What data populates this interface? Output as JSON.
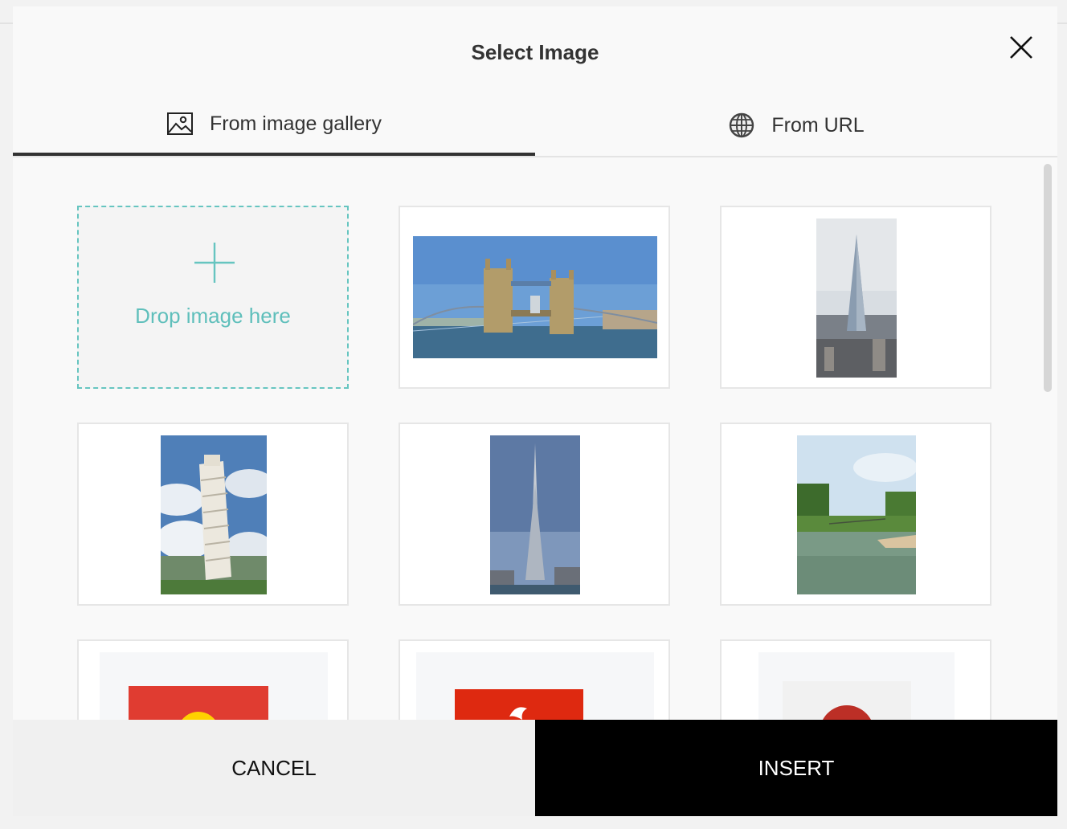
{
  "modal": {
    "title": "Select Image",
    "close_icon": "close-icon"
  },
  "tabs": [
    {
      "label": "From image gallery",
      "icon": "image-icon",
      "active": true
    },
    {
      "label": "From URL",
      "icon": "globe-icon",
      "active": false
    }
  ],
  "gallery": {
    "dropzone": {
      "text": "Drop image here",
      "icon": "plus-icon"
    },
    "images": [
      {
        "subject": "tower-bridge"
      },
      {
        "subject": "the-shard"
      },
      {
        "subject": "leaning-tower-of-pisa"
      },
      {
        "subject": "burj-khalifa"
      },
      {
        "subject": "river-landscape"
      },
      {
        "subject": "kyrgyzstan-flag"
      },
      {
        "subject": "hong-kong-flag"
      },
      {
        "subject": "japan-flag"
      }
    ]
  },
  "footer": {
    "cancel_label": "CANCEL",
    "insert_label": "INSERT"
  },
  "colors": {
    "accent": "#5fbfbb",
    "primary_button": "#000000",
    "active_tab_underline": "#333333"
  }
}
